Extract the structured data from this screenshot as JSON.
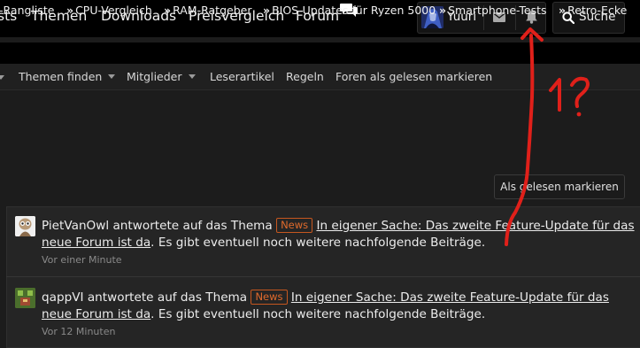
{
  "topnav": {
    "items": [
      "sts",
      "Themen",
      "Downloads",
      "Preisvergleich",
      "Forum"
    ],
    "user": "Yuuri",
    "search_label": "Suche"
  },
  "ticker": {
    "bullet": "»",
    "items": [
      "-Rangliste",
      "CPU-Vergleich",
      "RAM-Ratgeber",
      "BIOS-Updates für Ryzen 5000",
      "Smartphone-Tests",
      "Retro-Ecke"
    ]
  },
  "subnav": {
    "items": [
      "Themen finden",
      "Mitglieder",
      "Leserartikel",
      "Regeln",
      "Foren als gelesen markieren"
    ]
  },
  "mark_read_label": "Als gelesen markieren",
  "alerts": [
    {
      "user": "PietVanOwl",
      "action": " antwortete auf das Thema ",
      "badge": "News",
      "link1": "In eigener Sache: Das zweite Feature-Update für das",
      "link2": "neue Forum ist da",
      "suffix": ". Es gibt eventuell noch weitere nachfolgende Beiträge.",
      "time": "Vor einer Minute"
    },
    {
      "user": "qappVI",
      "action": " antwortete auf das Thema ",
      "badge": "News",
      "link1": "In eigener Sache: Das zweite Feature-Update für das",
      "link2": "neue Forum ist da",
      "suffix": ". Es gibt eventuell noch weitere nachfolgende Beiträge.",
      "time": "Vor 12 Minuten"
    }
  ],
  "annotation_text": "1?",
  "colors": {
    "badge": "#e06a2c",
    "annotation": "#e0201a"
  }
}
